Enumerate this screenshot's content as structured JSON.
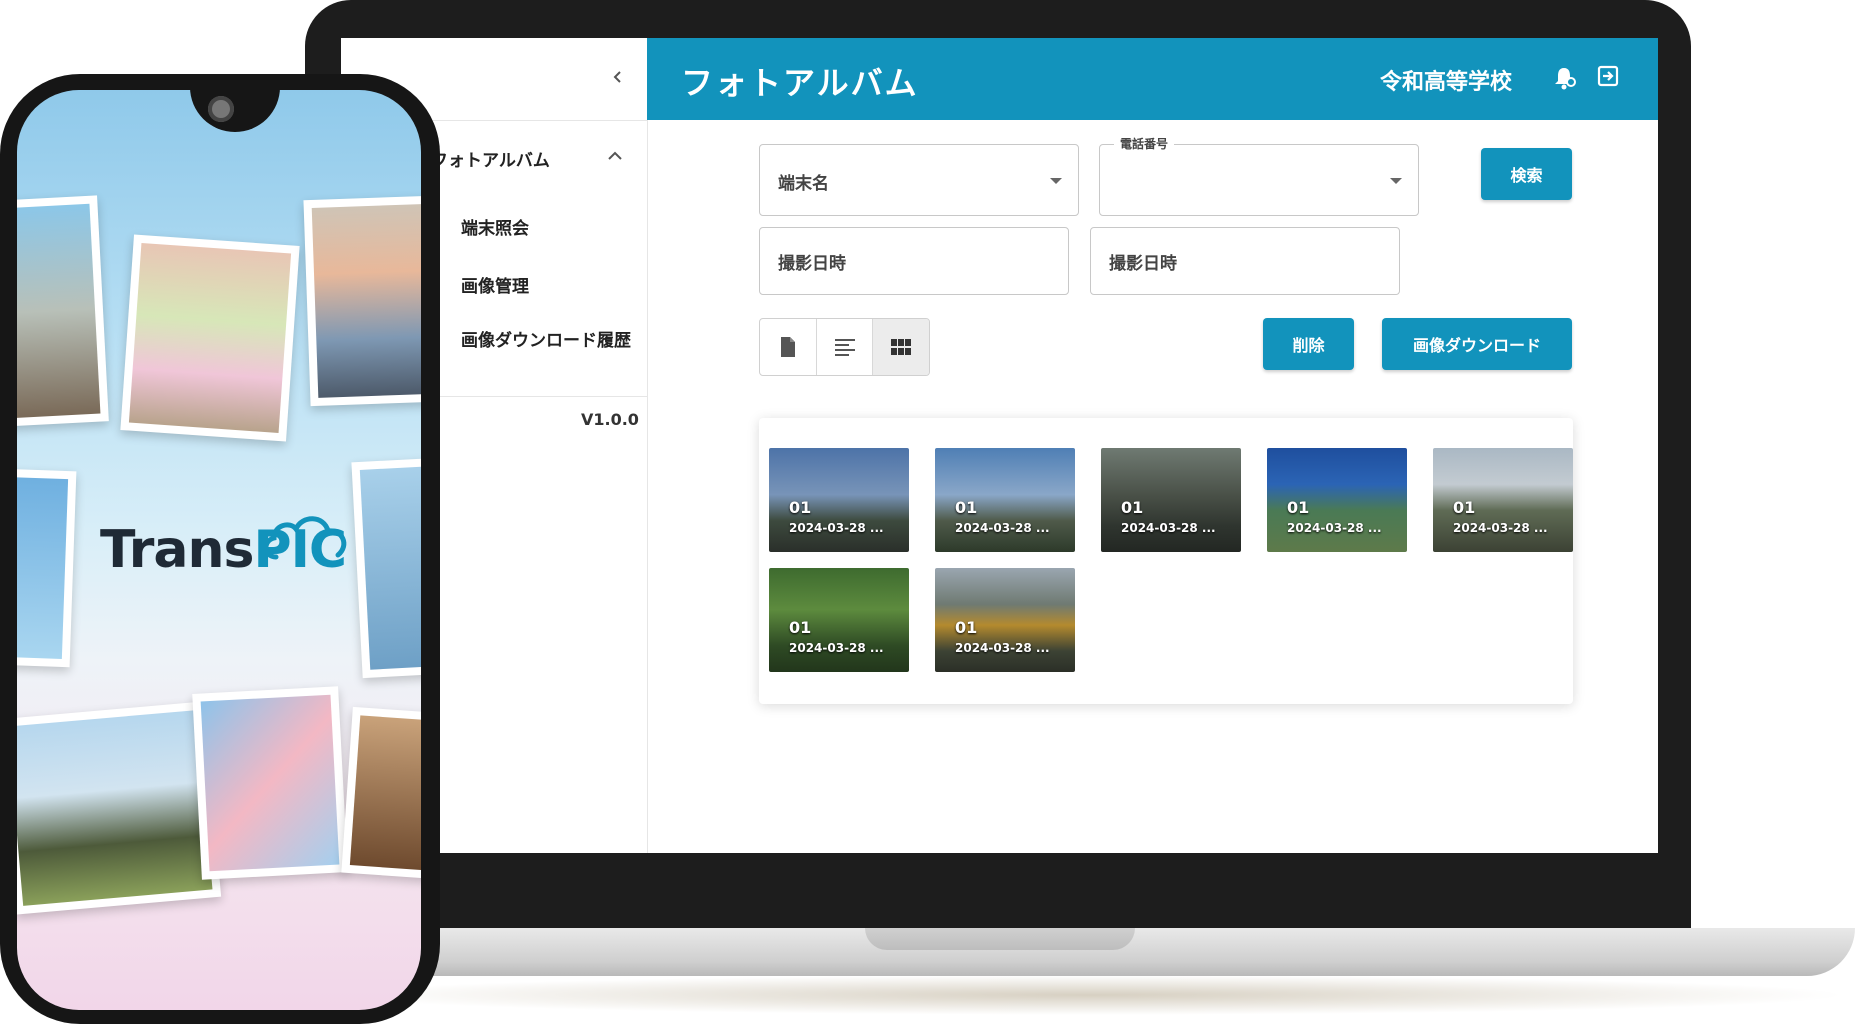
{
  "colors": {
    "accent": "#1293bc",
    "header_text": "#ffffff"
  },
  "sidebar": {
    "group_label": "フォトアルバム",
    "items": [
      {
        "label": "端末照会"
      },
      {
        "label": "画像管理"
      },
      {
        "label": "画像ダウンロード履歴"
      }
    ],
    "version": "V1.0.0",
    "icons": {
      "collapse": "chevron-left-icon",
      "group": "chevron-up-icon"
    }
  },
  "header": {
    "title": "フォトアルバム",
    "school": "令和高等学校",
    "icons": {
      "notification": "bell-icon",
      "logout": "logout-icon"
    }
  },
  "filters": {
    "terminal_placeholder": "端末名",
    "phone_label": "電話番号",
    "date_from_placeholder": "撮影日時",
    "date_to_placeholder": "撮影日時",
    "search_label": "検索"
  },
  "actions": {
    "delete_label": "削除",
    "download_label": "画像ダウンロード"
  },
  "view_modes": [
    {
      "icon": "file-icon"
    },
    {
      "icon": "list-icon"
    },
    {
      "icon": "grid-icon",
      "selected": true
    }
  ],
  "gallery": {
    "items": [
      {
        "no": "01",
        "date": "2024-03-28 ..."
      },
      {
        "no": "01",
        "date": "2024-03-28 ..."
      },
      {
        "no": "01",
        "date": "2024-03-28 ..."
      },
      {
        "no": "01",
        "date": "2024-03-28 ..."
      },
      {
        "no": "01",
        "date": "2024-03-28 ..."
      },
      {
        "no": "01",
        "date": "2024-03-28 ..."
      },
      {
        "no": "01",
        "date": "2024-03-28 ..."
      }
    ]
  },
  "phone": {
    "brand_prefix": "Trans",
    "brand_suffix": "PIC"
  }
}
